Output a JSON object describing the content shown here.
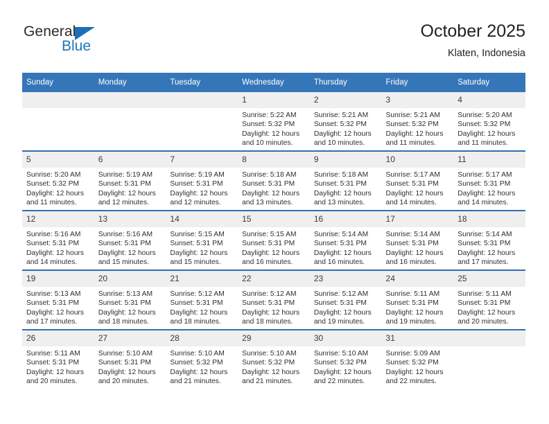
{
  "brand": {
    "name_top": "General",
    "name_bottom": "Blue",
    "accent_color": "#1b75bb"
  },
  "header": {
    "title": "October 2025",
    "subtitle": "Klaten, Indonesia"
  },
  "calendar": {
    "header_bg": "#3576b8",
    "daynum_bg": "#efefef",
    "separator_color": "#2f6fae",
    "weekday_headers": [
      "Sunday",
      "Monday",
      "Tuesday",
      "Wednesday",
      "Thursday",
      "Friday",
      "Saturday"
    ],
    "weeks": [
      [
        {
          "day": "",
          "sunrise": "",
          "sunset": "",
          "daylight_1": "",
          "daylight_2": ""
        },
        {
          "day": "",
          "sunrise": "",
          "sunset": "",
          "daylight_1": "",
          "daylight_2": ""
        },
        {
          "day": "",
          "sunrise": "",
          "sunset": "",
          "daylight_1": "",
          "daylight_2": ""
        },
        {
          "day": "1",
          "sunrise": "Sunrise: 5:22 AM",
          "sunset": "Sunset: 5:32 PM",
          "daylight_1": "Daylight: 12 hours",
          "daylight_2": "and 10 minutes."
        },
        {
          "day": "2",
          "sunrise": "Sunrise: 5:21 AM",
          "sunset": "Sunset: 5:32 PM",
          "daylight_1": "Daylight: 12 hours",
          "daylight_2": "and 10 minutes."
        },
        {
          "day": "3",
          "sunrise": "Sunrise: 5:21 AM",
          "sunset": "Sunset: 5:32 PM",
          "daylight_1": "Daylight: 12 hours",
          "daylight_2": "and 11 minutes."
        },
        {
          "day": "4",
          "sunrise": "Sunrise: 5:20 AM",
          "sunset": "Sunset: 5:32 PM",
          "daylight_1": "Daylight: 12 hours",
          "daylight_2": "and 11 minutes."
        }
      ],
      [
        {
          "day": "5",
          "sunrise": "Sunrise: 5:20 AM",
          "sunset": "Sunset: 5:32 PM",
          "daylight_1": "Daylight: 12 hours",
          "daylight_2": "and 11 minutes."
        },
        {
          "day": "6",
          "sunrise": "Sunrise: 5:19 AM",
          "sunset": "Sunset: 5:31 PM",
          "daylight_1": "Daylight: 12 hours",
          "daylight_2": "and 12 minutes."
        },
        {
          "day": "7",
          "sunrise": "Sunrise: 5:19 AM",
          "sunset": "Sunset: 5:31 PM",
          "daylight_1": "Daylight: 12 hours",
          "daylight_2": "and 12 minutes."
        },
        {
          "day": "8",
          "sunrise": "Sunrise: 5:18 AM",
          "sunset": "Sunset: 5:31 PM",
          "daylight_1": "Daylight: 12 hours",
          "daylight_2": "and 13 minutes."
        },
        {
          "day": "9",
          "sunrise": "Sunrise: 5:18 AM",
          "sunset": "Sunset: 5:31 PM",
          "daylight_1": "Daylight: 12 hours",
          "daylight_2": "and 13 minutes."
        },
        {
          "day": "10",
          "sunrise": "Sunrise: 5:17 AM",
          "sunset": "Sunset: 5:31 PM",
          "daylight_1": "Daylight: 12 hours",
          "daylight_2": "and 14 minutes."
        },
        {
          "day": "11",
          "sunrise": "Sunrise: 5:17 AM",
          "sunset": "Sunset: 5:31 PM",
          "daylight_1": "Daylight: 12 hours",
          "daylight_2": "and 14 minutes."
        }
      ],
      [
        {
          "day": "12",
          "sunrise": "Sunrise: 5:16 AM",
          "sunset": "Sunset: 5:31 PM",
          "daylight_1": "Daylight: 12 hours",
          "daylight_2": "and 14 minutes."
        },
        {
          "day": "13",
          "sunrise": "Sunrise: 5:16 AM",
          "sunset": "Sunset: 5:31 PM",
          "daylight_1": "Daylight: 12 hours",
          "daylight_2": "and 15 minutes."
        },
        {
          "day": "14",
          "sunrise": "Sunrise: 5:15 AM",
          "sunset": "Sunset: 5:31 PM",
          "daylight_1": "Daylight: 12 hours",
          "daylight_2": "and 15 minutes."
        },
        {
          "day": "15",
          "sunrise": "Sunrise: 5:15 AM",
          "sunset": "Sunset: 5:31 PM",
          "daylight_1": "Daylight: 12 hours",
          "daylight_2": "and 16 minutes."
        },
        {
          "day": "16",
          "sunrise": "Sunrise: 5:14 AM",
          "sunset": "Sunset: 5:31 PM",
          "daylight_1": "Daylight: 12 hours",
          "daylight_2": "and 16 minutes."
        },
        {
          "day": "17",
          "sunrise": "Sunrise: 5:14 AM",
          "sunset": "Sunset: 5:31 PM",
          "daylight_1": "Daylight: 12 hours",
          "daylight_2": "and 16 minutes."
        },
        {
          "day": "18",
          "sunrise": "Sunrise: 5:14 AM",
          "sunset": "Sunset: 5:31 PM",
          "daylight_1": "Daylight: 12 hours",
          "daylight_2": "and 17 minutes."
        }
      ],
      [
        {
          "day": "19",
          "sunrise": "Sunrise: 5:13 AM",
          "sunset": "Sunset: 5:31 PM",
          "daylight_1": "Daylight: 12 hours",
          "daylight_2": "and 17 minutes."
        },
        {
          "day": "20",
          "sunrise": "Sunrise: 5:13 AM",
          "sunset": "Sunset: 5:31 PM",
          "daylight_1": "Daylight: 12 hours",
          "daylight_2": "and 18 minutes."
        },
        {
          "day": "21",
          "sunrise": "Sunrise: 5:12 AM",
          "sunset": "Sunset: 5:31 PM",
          "daylight_1": "Daylight: 12 hours",
          "daylight_2": "and 18 minutes."
        },
        {
          "day": "22",
          "sunrise": "Sunrise: 5:12 AM",
          "sunset": "Sunset: 5:31 PM",
          "daylight_1": "Daylight: 12 hours",
          "daylight_2": "and 18 minutes."
        },
        {
          "day": "23",
          "sunrise": "Sunrise: 5:12 AM",
          "sunset": "Sunset: 5:31 PM",
          "daylight_1": "Daylight: 12 hours",
          "daylight_2": "and 19 minutes."
        },
        {
          "day": "24",
          "sunrise": "Sunrise: 5:11 AM",
          "sunset": "Sunset: 5:31 PM",
          "daylight_1": "Daylight: 12 hours",
          "daylight_2": "and 19 minutes."
        },
        {
          "day": "25",
          "sunrise": "Sunrise: 5:11 AM",
          "sunset": "Sunset: 5:31 PM",
          "daylight_1": "Daylight: 12 hours",
          "daylight_2": "and 20 minutes."
        }
      ],
      [
        {
          "day": "26",
          "sunrise": "Sunrise: 5:11 AM",
          "sunset": "Sunset: 5:31 PM",
          "daylight_1": "Daylight: 12 hours",
          "daylight_2": "and 20 minutes."
        },
        {
          "day": "27",
          "sunrise": "Sunrise: 5:10 AM",
          "sunset": "Sunset: 5:31 PM",
          "daylight_1": "Daylight: 12 hours",
          "daylight_2": "and 20 minutes."
        },
        {
          "day": "28",
          "sunrise": "Sunrise: 5:10 AM",
          "sunset": "Sunset: 5:32 PM",
          "daylight_1": "Daylight: 12 hours",
          "daylight_2": "and 21 minutes."
        },
        {
          "day": "29",
          "sunrise": "Sunrise: 5:10 AM",
          "sunset": "Sunset: 5:32 PM",
          "daylight_1": "Daylight: 12 hours",
          "daylight_2": "and 21 minutes."
        },
        {
          "day": "30",
          "sunrise": "Sunrise: 5:10 AM",
          "sunset": "Sunset: 5:32 PM",
          "daylight_1": "Daylight: 12 hours",
          "daylight_2": "and 22 minutes."
        },
        {
          "day": "31",
          "sunrise": "Sunrise: 5:09 AM",
          "sunset": "Sunset: 5:32 PM",
          "daylight_1": "Daylight: 12 hours",
          "daylight_2": "and 22 minutes."
        },
        {
          "day": "",
          "sunrise": "",
          "sunset": "",
          "daylight_1": "",
          "daylight_2": ""
        }
      ]
    ]
  }
}
